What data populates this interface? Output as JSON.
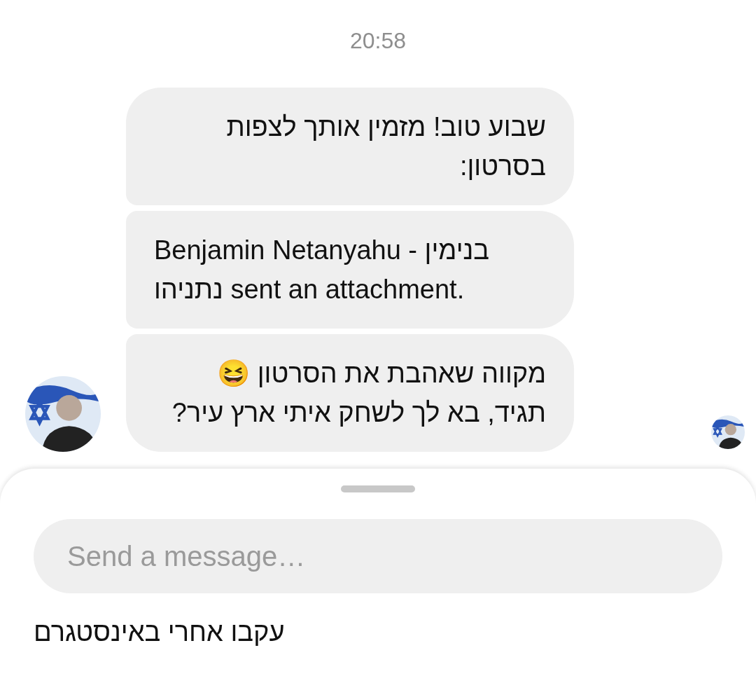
{
  "timestamp": "20:58",
  "messages": [
    {
      "text": "שבוע טוב! מזמין אותך לצפות בסרטון:"
    },
    {
      "text": "Benjamin Netanyahu - בנימין נתניהו sent an attachment."
    },
    {
      "text": "מקווה שאהבת את הסרטון 😆 תגיד, בא לך לשחק איתי ארץ עיר?"
    }
  ],
  "composer": {
    "placeholder": "Send a message…"
  },
  "footer_text": "עקבו אחרי באינסטגרם"
}
